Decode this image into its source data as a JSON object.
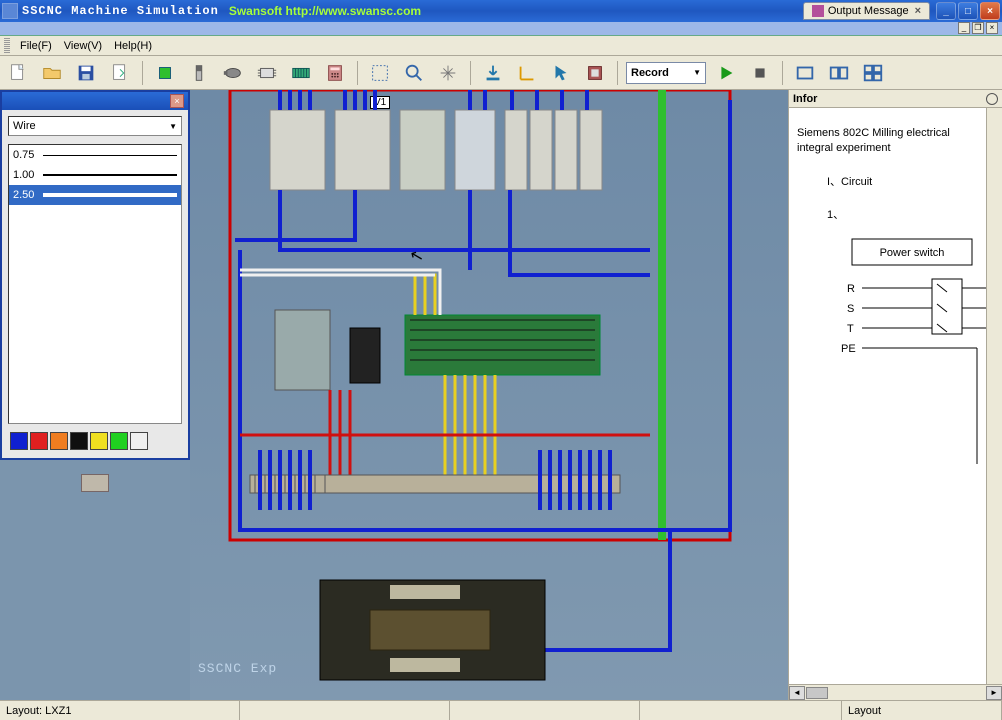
{
  "window": {
    "title": "SSCNC Machine Simulation",
    "watermark_url": "Swansoft http://www.swansc.com",
    "output_tab": "Output Message"
  },
  "menu": {
    "file": "File(F)",
    "view": "View(V)",
    "help": "Help(H)"
  },
  "toolbar": {
    "record_label": "Record"
  },
  "wire_panel": {
    "combo": "Wire",
    "sizes": [
      "0.75",
      "1.00",
      "2.50"
    ],
    "selected_index": 2,
    "colors": [
      "#1020d0",
      "#e02020",
      "#f07d20",
      "#101010",
      "#f0e020",
      "#20d020",
      "#f0f0f0"
    ]
  },
  "canvas": {
    "tag": "V1",
    "watermark": "SSCNC Exp"
  },
  "info": {
    "title": "Infor",
    "heading": "Siemens 802C Milling electrical integral experiment",
    "sec1": "I、Circuit",
    "sec1_1": "1、",
    "box_label": "Power switch",
    "legend": [
      "R",
      "S",
      "T",
      "PE"
    ]
  },
  "status": {
    "layout": "Layout: LXZ1",
    "right": "Layout"
  }
}
